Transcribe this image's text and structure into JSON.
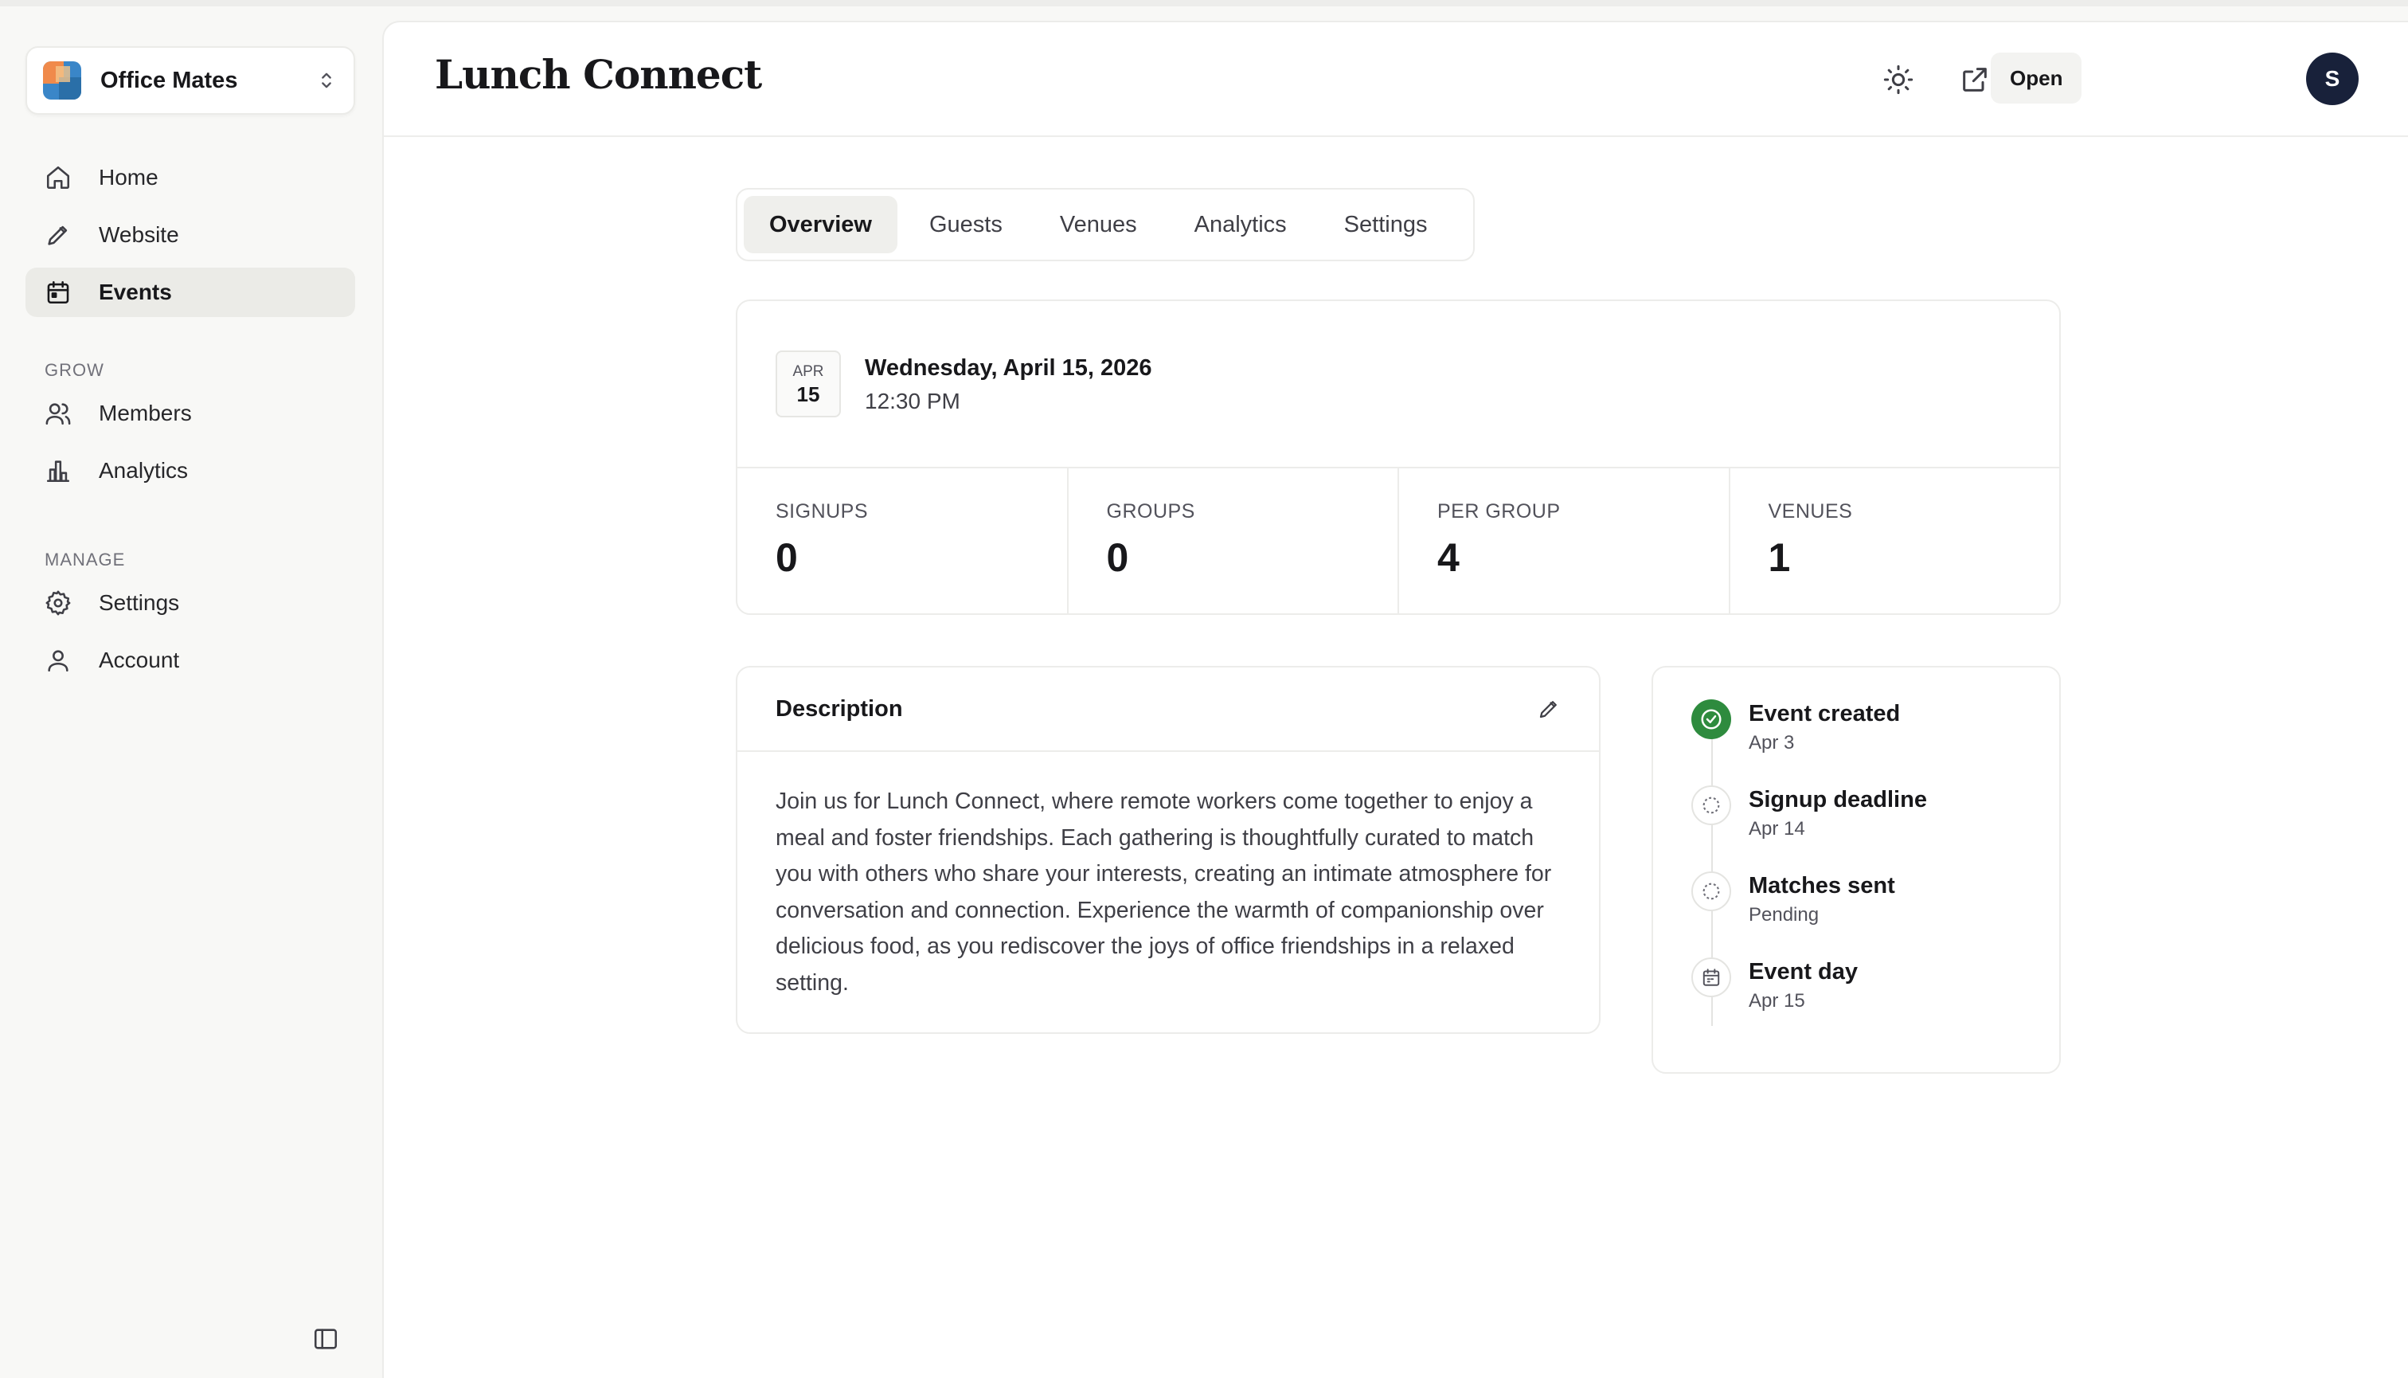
{
  "org": {
    "name": "Office Mates"
  },
  "sidebar": {
    "primary": [
      {
        "label": "Home",
        "icon": "home-icon"
      },
      {
        "label": "Website",
        "icon": "pencil-icon"
      },
      {
        "label": "Events",
        "icon": "calendar-icon",
        "active": true
      }
    ],
    "sections": [
      {
        "title": "GROW",
        "items": [
          {
            "label": "Members",
            "icon": "users-icon"
          },
          {
            "label": "Analytics",
            "icon": "bar-chart-icon"
          }
        ]
      },
      {
        "title": "MANAGE",
        "items": [
          {
            "label": "Settings",
            "icon": "gear-icon"
          },
          {
            "label": "Account",
            "icon": "user-icon"
          }
        ]
      }
    ]
  },
  "header": {
    "title": "Lunch Connect",
    "status": "Open",
    "avatar_initial": "S"
  },
  "tabs": [
    {
      "label": "Overview",
      "active": true
    },
    {
      "label": "Guests"
    },
    {
      "label": "Venues"
    },
    {
      "label": "Analytics"
    },
    {
      "label": "Settings"
    }
  ],
  "event": {
    "month": "APR",
    "day": "15",
    "date_full": "Wednesday, April 15, 2026",
    "time": "12:30 PM"
  },
  "stats": [
    {
      "label": "SIGNUPS",
      "value": "0"
    },
    {
      "label": "GROUPS",
      "value": "0"
    },
    {
      "label": "PER GROUP",
      "value": "4"
    },
    {
      "label": "VENUES",
      "value": "1"
    }
  ],
  "description": {
    "title": "Description",
    "body": "Join us for Lunch Connect, where remote workers come together to enjoy a meal and foster friendships. Each gathering is thoughtfully curated to match you with others who share your interests, creating an intimate atmosphere for conversation and connection. Experience the warmth of companionship over delicious food, as you rediscover the joys of office friendships in a relaxed setting."
  },
  "timeline": [
    {
      "title": "Event created",
      "sub": "Apr 3",
      "state": "done"
    },
    {
      "title": "Signup deadline",
      "sub": "Apr 14",
      "state": "pending"
    },
    {
      "title": "Matches sent",
      "sub": "Pending",
      "state": "pending"
    },
    {
      "title": "Event day",
      "sub": "Apr 15",
      "state": "event"
    }
  ],
  "colors": {
    "accent_done": "#2e8b3e",
    "avatar_bg": "#18213a",
    "active_bg": "#ebebe7"
  }
}
